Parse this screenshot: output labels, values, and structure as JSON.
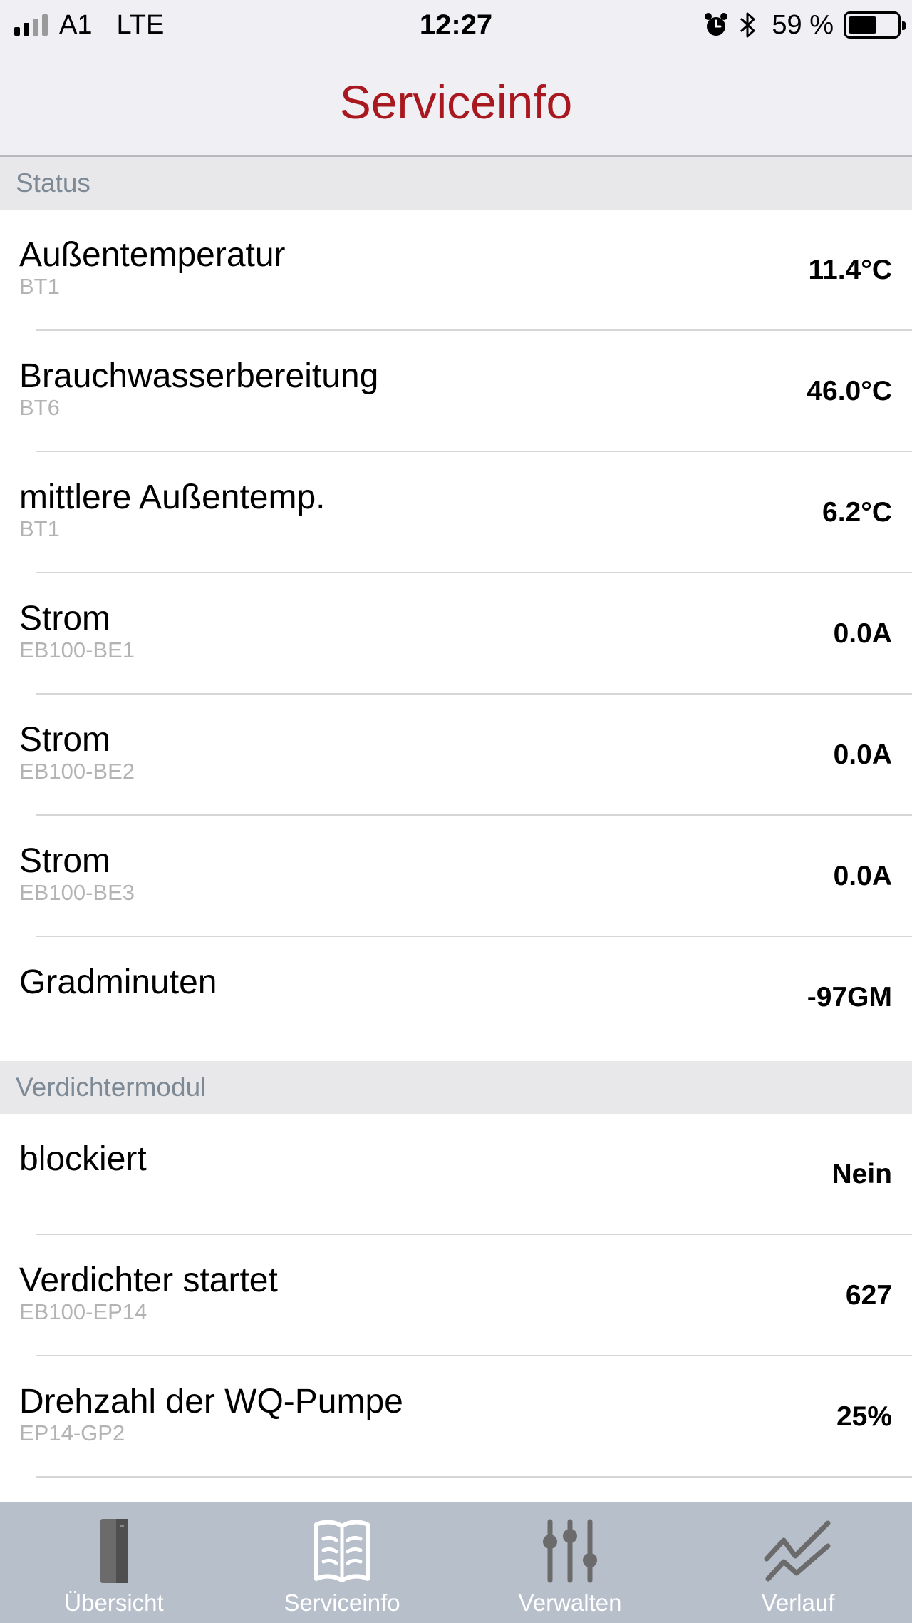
{
  "status_bar": {
    "carrier": "A1",
    "network": "LTE",
    "time": "12:27",
    "battery": "59 %",
    "battery_level": 0.59
  },
  "header": {
    "title": "Serviceinfo"
  },
  "sections": [
    {
      "title": "Status",
      "rows": [
        {
          "label": "Außentemperatur",
          "sub": "BT1",
          "value": "11.4°C"
        },
        {
          "label": "Brauchwasserbereitung",
          "sub": "BT6",
          "value": "46.0°C"
        },
        {
          "label": "mittlere Außentemp.",
          "sub": "BT1",
          "value": "6.2°C"
        },
        {
          "label": "Strom",
          "sub": "EB100-BE1",
          "value": "0.0A"
        },
        {
          "label": "Strom",
          "sub": "EB100-BE2",
          "value": "0.0A"
        },
        {
          "label": "Strom",
          "sub": "EB100-BE3",
          "value": "0.0A"
        },
        {
          "label": "Gradminuten",
          "sub": "",
          "value": "-97GM"
        }
      ]
    },
    {
      "title": "Verdichtermodul",
      "rows": [
        {
          "label": "blockiert",
          "sub": "",
          "value": "Nein"
        },
        {
          "label": "Verdichter startet",
          "sub": "EB100-EP14",
          "value": "627"
        },
        {
          "label": "Drehzahl der WQ-Pumpe",
          "sub": "EP14-GP2",
          "value": "25%"
        }
      ]
    }
  ],
  "tab_bar": {
    "tabs": [
      {
        "label": "Übersicht",
        "icon": "unit-icon"
      },
      {
        "label": "Serviceinfo",
        "icon": "book-icon",
        "selected": true
      },
      {
        "label": "Verwalten",
        "icon": "sliders-icon"
      },
      {
        "label": "Verlauf",
        "icon": "chart-icon"
      }
    ]
  }
}
